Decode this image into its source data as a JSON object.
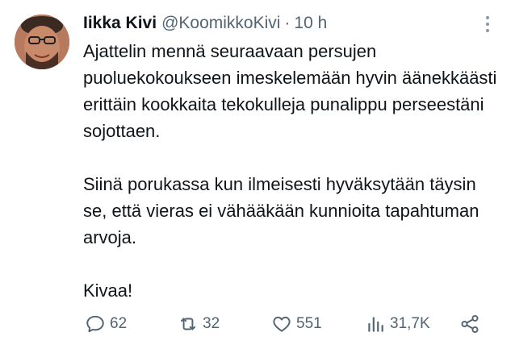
{
  "author": {
    "display_name": "Iikka Kivi",
    "handle": "@KoomikkoKivi",
    "separator": "·",
    "time": "10 h",
    "avatar_icon": "profile-photo"
  },
  "tweet": {
    "paragraphs": [
      "Ajattelin mennä seuraavaan persujen puoluekokoukseen imeskelemään hyvin äänekkäästi erittäin kookkaita tekokulleja punalippu perseestäni sojottaen.",
      "Siinä porukassa kun ilmeisesti hyväksytään täysin se, että vieras ei vähääkään kunnioita tapahtuman arvoja.",
      "Kivaa!"
    ]
  },
  "actions": {
    "reply": {
      "icon": "reply-icon",
      "count": "62"
    },
    "retweet": {
      "icon": "retweet-icon",
      "count": "32"
    },
    "like": {
      "icon": "heart-icon",
      "count": "551"
    },
    "views": {
      "icon": "views-icon",
      "count": "31,7K"
    },
    "share": {
      "icon": "share-icon"
    }
  },
  "more_menu": {
    "icon": "more-vertical-icon"
  },
  "colors": {
    "text": "#0f1419",
    "secondary": "#536471",
    "background": "#ffffff"
  }
}
